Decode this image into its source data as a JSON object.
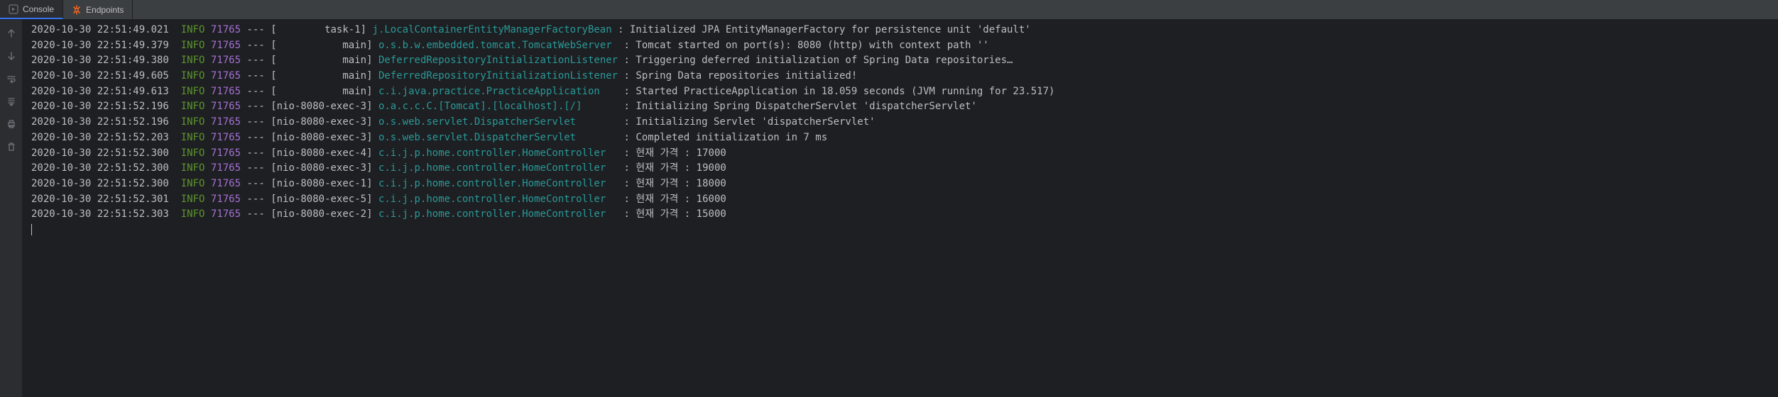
{
  "tabs": {
    "console": "Console",
    "endpoints": "Endpoints"
  },
  "colors": {
    "background": "#1e1f22",
    "panel": "#2b2d30",
    "accent": "#3574f0",
    "info": "#5c962c",
    "pid": "#a571d6",
    "logger": "#299999",
    "endpoint_icon": "#f26522"
  },
  "log": [
    {
      "ts": "2020-10-30 22:51:49.021",
      "level": "INFO",
      "pid": "71765",
      "thread": "[        task-1]",
      "logger": "j.LocalContainerEntityManagerFactoryBean",
      "msg": "Initialized JPA EntityManagerFactory for persistence unit 'default'"
    },
    {
      "ts": "2020-10-30 22:51:49.379",
      "level": "INFO",
      "pid": "71765",
      "thread": "[           main]",
      "logger": "o.s.b.w.embedded.tomcat.TomcatWebServer ",
      "msg": "Tomcat started on port(s): 8080 (http) with context path ''"
    },
    {
      "ts": "2020-10-30 22:51:49.380",
      "level": "INFO",
      "pid": "71765",
      "thread": "[           main]",
      "logger": "DeferredRepositoryInitializationListener",
      "msg": "Triggering deferred initialization of Spring Data repositories…"
    },
    {
      "ts": "2020-10-30 22:51:49.605",
      "level": "INFO",
      "pid": "71765",
      "thread": "[           main]",
      "logger": "DeferredRepositoryInitializationListener",
      "msg": "Spring Data repositories initialized!"
    },
    {
      "ts": "2020-10-30 22:51:49.613",
      "level": "INFO",
      "pid": "71765",
      "thread": "[           main]",
      "logger": "c.i.java.practice.PracticeApplication   ",
      "msg": "Started PracticeApplication in 18.059 seconds (JVM running for 23.517)"
    },
    {
      "ts": "2020-10-30 22:51:52.196",
      "level": "INFO",
      "pid": "71765",
      "thread": "[nio-8080-exec-3]",
      "logger": "o.a.c.c.C.[Tomcat].[localhost].[/]      ",
      "msg": "Initializing Spring DispatcherServlet 'dispatcherServlet'"
    },
    {
      "ts": "2020-10-30 22:51:52.196",
      "level": "INFO",
      "pid": "71765",
      "thread": "[nio-8080-exec-3]",
      "logger": "o.s.web.servlet.DispatcherServlet       ",
      "msg": "Initializing Servlet 'dispatcherServlet'"
    },
    {
      "ts": "2020-10-30 22:51:52.203",
      "level": "INFO",
      "pid": "71765",
      "thread": "[nio-8080-exec-3]",
      "logger": "o.s.web.servlet.DispatcherServlet       ",
      "msg": "Completed initialization in 7 ms"
    },
    {
      "ts": "2020-10-30 22:51:52.300",
      "level": "INFO",
      "pid": "71765",
      "thread": "[nio-8080-exec-4]",
      "logger": "c.i.j.p.home.controller.HomeController  ",
      "msg": "현재 가격 : 17000"
    },
    {
      "ts": "2020-10-30 22:51:52.300",
      "level": "INFO",
      "pid": "71765",
      "thread": "[nio-8080-exec-3]",
      "logger": "c.i.j.p.home.controller.HomeController  ",
      "msg": "현재 가격 : 19000"
    },
    {
      "ts": "2020-10-30 22:51:52.300",
      "level": "INFO",
      "pid": "71765",
      "thread": "[nio-8080-exec-1]",
      "logger": "c.i.j.p.home.controller.HomeController  ",
      "msg": "현재 가격 : 18000"
    },
    {
      "ts": "2020-10-30 22:51:52.301",
      "level": "INFO",
      "pid": "71765",
      "thread": "[nio-8080-exec-5]",
      "logger": "c.i.j.p.home.controller.HomeController  ",
      "msg": "현재 가격 : 16000"
    },
    {
      "ts": "2020-10-30 22:51:52.303",
      "level": "INFO",
      "pid": "71765",
      "thread": "[nio-8080-exec-2]",
      "logger": "c.i.j.p.home.controller.HomeController  ",
      "msg": "현재 가격 : 15000"
    }
  ]
}
